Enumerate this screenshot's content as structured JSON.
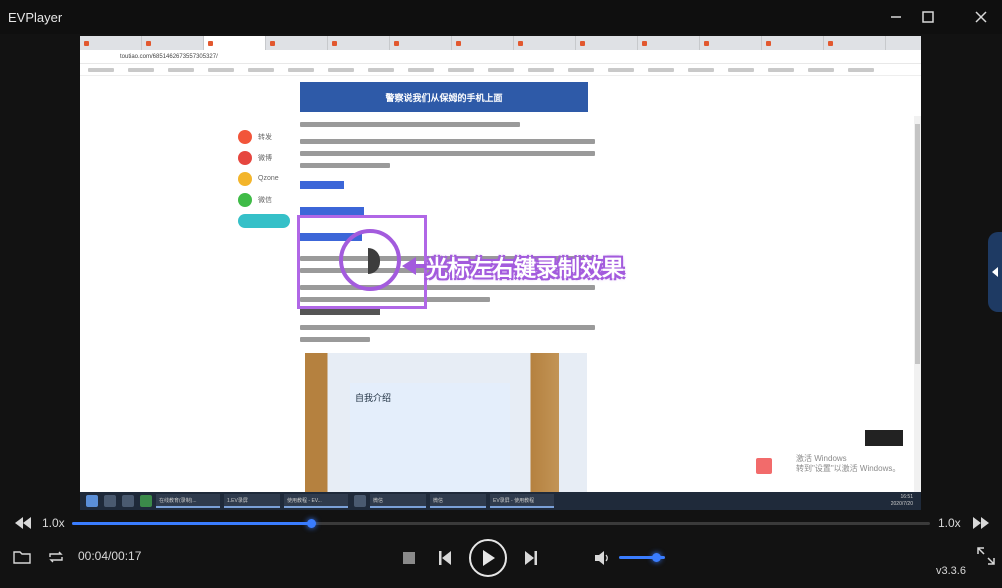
{
  "window": {
    "title": "EVPlayer"
  },
  "controls": {
    "left_speed": "1.0x",
    "right_speed": "1.0x",
    "time": "00:04/00:17",
    "version": "v3.3.6",
    "progress_fraction": 0.279,
    "volume_fraction": 0.8
  },
  "video": {
    "url": "toutiao.com/6851462673557305327/",
    "banner_text": "警察说我们从保姆的手机上面",
    "annotation": "光标左右键录制效果",
    "photo_caption": "自我介绍",
    "watermark_line1": "激活 Windows",
    "watermark_line2": "转到\"设置\"以激活 Windows。",
    "share_items": [
      "转发",
      "微博",
      "Qzone",
      "微信"
    ],
    "taskbar_items": [
      "在线教育(录制)...",
      "1.EV录屏",
      "使用教程 - EV...",
      "微信",
      "微信",
      "EV录屏 - 使用教程"
    ],
    "clock_time": "16:51",
    "clock_date": "2020/7/20"
  },
  "icons": {
    "minimize": "minimize-icon",
    "maximize": "maximize-icon",
    "close": "close-icon",
    "rewind": "rewind-icon",
    "forward": "fast-forward-icon",
    "folder": "folder-icon",
    "loop": "loop-icon",
    "stop": "stop-icon",
    "prev": "skip-back-icon",
    "play": "play-icon",
    "next": "skip-forward-icon",
    "volume": "volume-icon",
    "fullscreen": "fullscreen-icon"
  },
  "colors": {
    "accent": "#3a7dff",
    "annotation": "#a35bdd"
  }
}
